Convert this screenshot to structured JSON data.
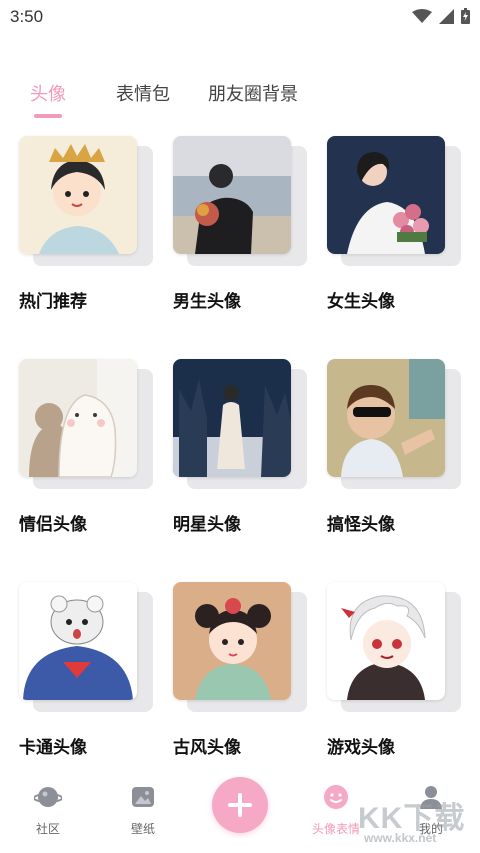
{
  "status_bar": {
    "time": "3:50"
  },
  "tabs": [
    {
      "label": "头像",
      "active": true
    },
    {
      "label": "表情包",
      "active": false
    },
    {
      "label": "朋友圈背景",
      "active": false
    }
  ],
  "categories": [
    {
      "label": "热门推荐"
    },
    {
      "label": "男生头像"
    },
    {
      "label": "女生头像"
    },
    {
      "label": "情侣头像"
    },
    {
      "label": "明星头像"
    },
    {
      "label": "搞怪头像"
    },
    {
      "label": "卡通头像"
    },
    {
      "label": "古风头像"
    },
    {
      "label": "游戏头像"
    }
  ],
  "bottom_nav": {
    "community": "社区",
    "wallpaper": "壁纸",
    "avatar_emoji": "头像表情",
    "mine": "我的"
  },
  "watermark": {
    "logo": "KK下载",
    "url": "www.kkx.net"
  },
  "colors": {
    "accent": "#f39ab9",
    "add_button": "#f5a9c5"
  }
}
